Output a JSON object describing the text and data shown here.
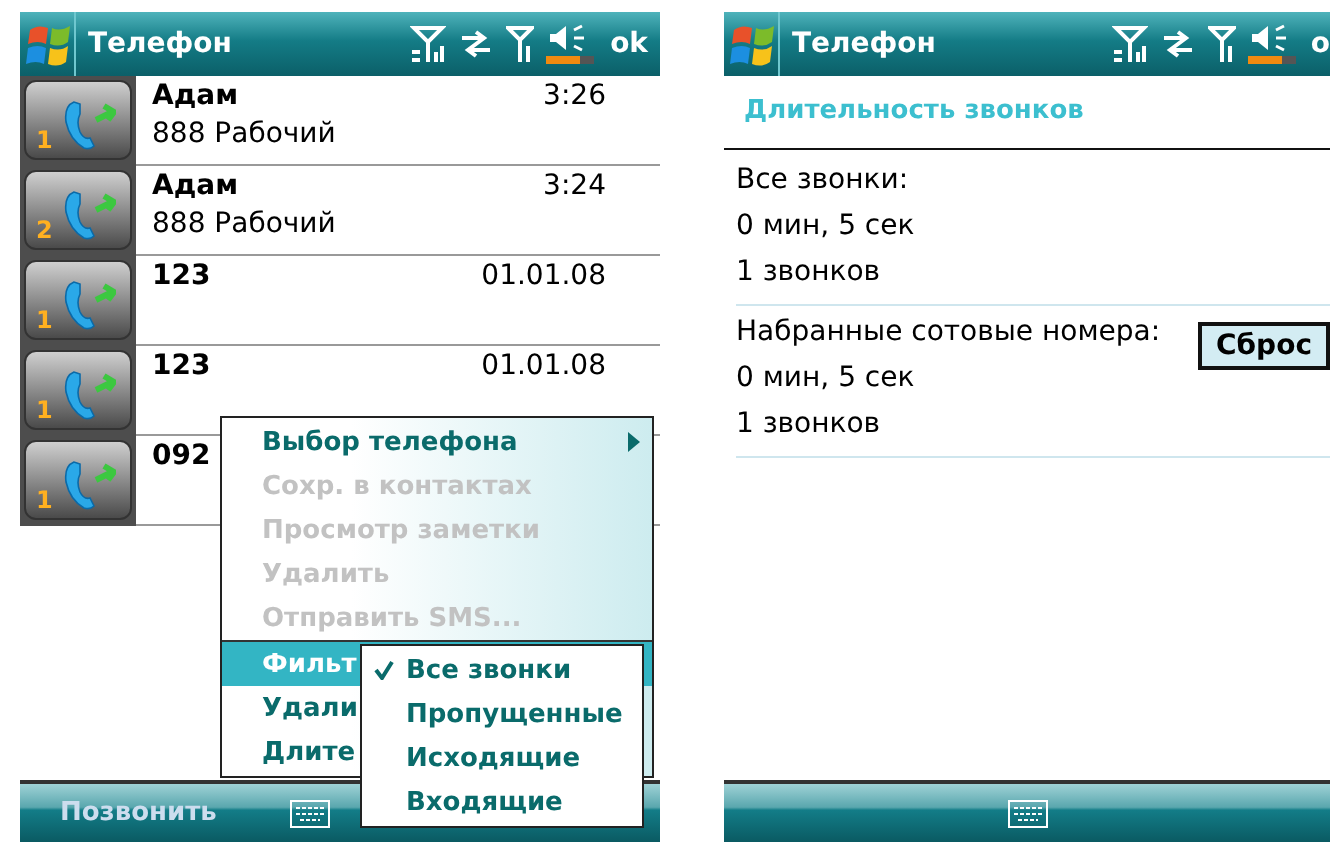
{
  "left_screen": {
    "title": "Телефон",
    "ok": "ok",
    "calls": [
      {
        "name": "Адам",
        "detail": "888 Рабочий",
        "time": "3:26",
        "line": "1"
      },
      {
        "name": "Адам",
        "detail": "888 Рабочий",
        "time": "3:24",
        "line": "2"
      },
      {
        "name": "123",
        "time": "01.01.08",
        "line": "1"
      },
      {
        "name": "123",
        "time": "01.01.08",
        "line": "1"
      },
      {
        "name": "092",
        "line": "1"
      }
    ],
    "menu": [
      {
        "label": "Выбор телефона",
        "disabled": false,
        "selected": false,
        "submenu": true
      },
      {
        "label": "Сохр. в контактах",
        "disabled": true,
        "selected": false,
        "submenu": false
      },
      {
        "label": "Просмотр заметки",
        "disabled": true,
        "selected": false,
        "submenu": false
      },
      {
        "label": "Удалить",
        "disabled": true,
        "selected": false,
        "submenu": false
      },
      {
        "label": "Отправить SMS...",
        "disabled": true,
        "selected": false,
        "submenu": false
      },
      {
        "label": "Фильт",
        "disabled": false,
        "selected": true,
        "submenu": true
      },
      {
        "label": "Удали",
        "disabled": false,
        "selected": false,
        "submenu": false
      },
      {
        "label": "Длите",
        "disabled": false,
        "selected": false,
        "submenu": false
      }
    ],
    "submenu": [
      {
        "label": "Все звонки",
        "checked": true
      },
      {
        "label": "Пропущенные",
        "checked": false
      },
      {
        "label": "Исходящие",
        "checked": false
      },
      {
        "label": "Входящие",
        "checked": false
      }
    ],
    "softkey_left": "Позвонить"
  },
  "right_screen": {
    "title": "Телефон",
    "ok": "o",
    "heading": "Длительность звонков",
    "sections": [
      {
        "label": "Все звонки:",
        "duration": "0 мин, 5 сек",
        "count": "1 звонков"
      },
      {
        "label": "Набранные сотовые номера:",
        "duration": "0 мин, 5 сек",
        "count": "1 звонков",
        "button": "Сброс"
      }
    ]
  }
}
